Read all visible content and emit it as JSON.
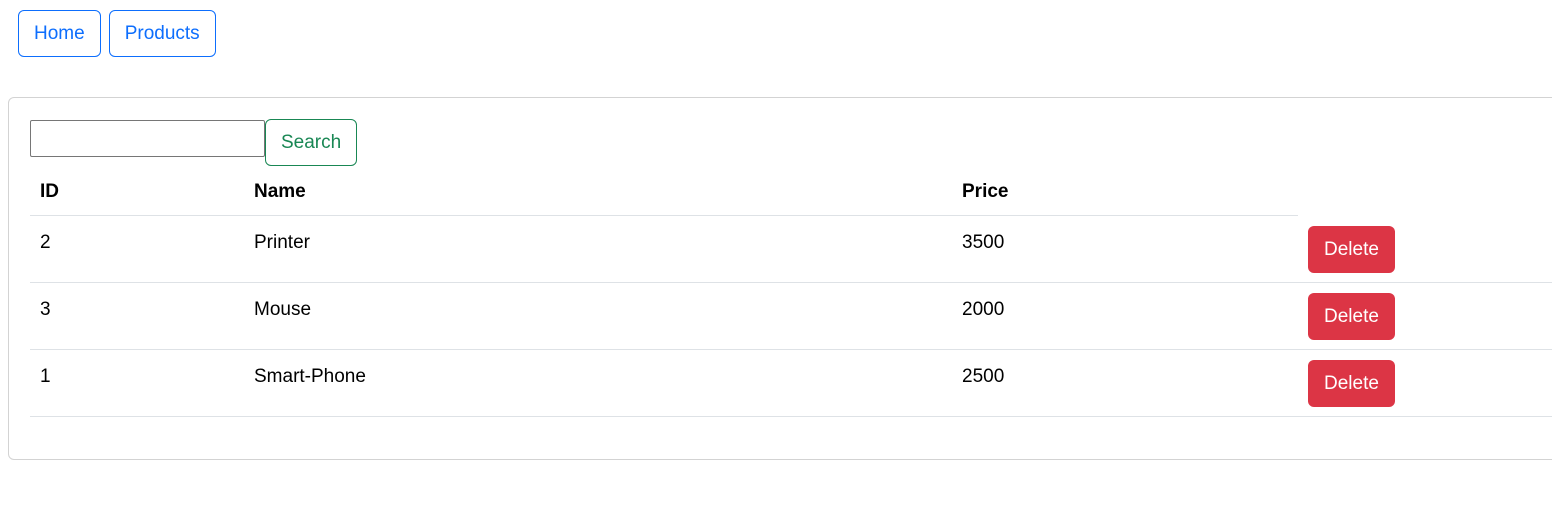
{
  "nav": {
    "home_label": "Home",
    "products_label": "Products"
  },
  "search": {
    "value": "",
    "placeholder": "",
    "button_label": "Search"
  },
  "table": {
    "headers": {
      "id": "ID",
      "name": "Name",
      "price": "Price"
    },
    "rows": [
      {
        "id": "2",
        "name": "Printer",
        "price": "3500",
        "action_label": "Delete"
      },
      {
        "id": "3",
        "name": "Mouse",
        "price": "2000",
        "action_label": "Delete"
      },
      {
        "id": "1",
        "name": "Smart-Phone",
        "price": "2500",
        "action_label": "Delete"
      }
    ]
  },
  "colors": {
    "primary": "#0d6efd",
    "success": "#198754",
    "danger": "#dc3545",
    "border": "#dee2e6"
  }
}
